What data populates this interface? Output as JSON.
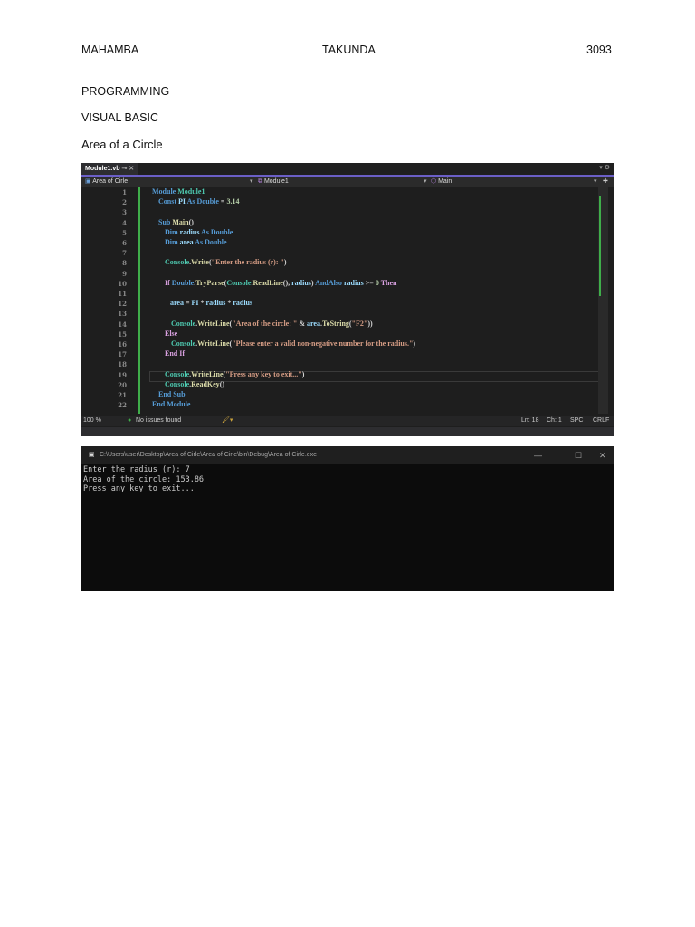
{
  "header": {
    "last_name": "MAHAMBA",
    "first_name": "TAKUNDA",
    "number": "3093"
  },
  "subject": "PROGRAMMING",
  "language": "VISUAL BASIC",
  "title": "Area of a Circle",
  "ide": {
    "tab": "Module1.vb",
    "tab_pin": "⊸",
    "tab_close": "✕",
    "nav": {
      "project": "Area of Cirle",
      "module": "Module1",
      "member": "Main"
    },
    "lines": [
      [
        [
          "Module ",
          "kw"
        ],
        [
          "Module1",
          "ty"
        ]
      ],
      [
        [
          "Const ",
          "kw"
        ],
        [
          "PI ",
          "var"
        ],
        [
          "As ",
          "kw"
        ],
        [
          "Double",
          "kw"
        ],
        [
          " = ",
          "op"
        ],
        [
          "3.14",
          "num"
        ]
      ],
      [],
      [
        [
          "Sub ",
          "kw"
        ],
        [
          "Main",
          "fn"
        ],
        [
          "()",
          "op"
        ]
      ],
      [
        [
          "Dim ",
          "kw"
        ],
        [
          "radius ",
          "var"
        ],
        [
          "As ",
          "kw"
        ],
        [
          "Double",
          "kw"
        ]
      ],
      [
        [
          "Dim ",
          "kw"
        ],
        [
          "area ",
          "var"
        ],
        [
          "As ",
          "kw"
        ],
        [
          "Double",
          "kw"
        ]
      ],
      [],
      [
        [
          "Console",
          "ty"
        ],
        [
          ".",
          "op"
        ],
        [
          "Write",
          "fn"
        ],
        [
          "(",
          "op"
        ],
        [
          "\"Enter the radius (r): \"",
          "str"
        ],
        [
          ")",
          "op"
        ]
      ],
      [],
      [
        [
          "If ",
          "ctl"
        ],
        [
          "Double",
          "kw"
        ],
        [
          ".",
          "op"
        ],
        [
          "TryParse",
          "fn"
        ],
        [
          "(",
          "op"
        ],
        [
          "Console",
          "ty"
        ],
        [
          ".",
          "op"
        ],
        [
          "ReadLine",
          "fn"
        ],
        [
          "(), ",
          "op"
        ],
        [
          "radius",
          "var"
        ],
        [
          ") ",
          "op"
        ],
        [
          "AndAlso ",
          "kw"
        ],
        [
          "radius ",
          "var"
        ],
        [
          ">= ",
          "op"
        ],
        [
          "0 ",
          "num"
        ],
        [
          "Then",
          "ctl"
        ]
      ],
      [],
      [
        [
          "area ",
          "var"
        ],
        [
          "= ",
          "op"
        ],
        [
          "PI ",
          "var"
        ],
        [
          "* ",
          "op"
        ],
        [
          "radius ",
          "var"
        ],
        [
          "* ",
          "op"
        ],
        [
          "radius",
          "var"
        ]
      ],
      [],
      [
        [
          "Console",
          "ty"
        ],
        [
          ".",
          "op"
        ],
        [
          "WriteLine",
          "fn"
        ],
        [
          "(",
          "op"
        ],
        [
          "\"Area of the circle: \"",
          "str"
        ],
        [
          " & ",
          "op"
        ],
        [
          "area",
          "var"
        ],
        [
          ".",
          "op"
        ],
        [
          "ToString",
          "fn"
        ],
        [
          "(",
          "op"
        ],
        [
          "\"F2\"",
          "str"
        ],
        [
          "))",
          "op"
        ]
      ],
      [
        [
          "Else",
          "ctl"
        ]
      ],
      [
        [
          "Console",
          "ty"
        ],
        [
          ".",
          "op"
        ],
        [
          "WriteLine",
          "fn"
        ],
        [
          "(",
          "op"
        ],
        [
          "\"Please enter a valid non-negative number for the radius.\"",
          "str"
        ],
        [
          ")",
          "op"
        ]
      ],
      [
        [
          "End If",
          "ctl"
        ]
      ],
      [],
      [
        [
          "Console",
          "ty"
        ],
        [
          ".",
          "op"
        ],
        [
          "WriteLine",
          "fn"
        ],
        [
          "(",
          "op"
        ],
        [
          "\"Press any key to exit...\"",
          "str"
        ],
        [
          ")",
          "op"
        ]
      ],
      [
        [
          "Console",
          "ty"
        ],
        [
          ".",
          "op"
        ],
        [
          "ReadKey",
          "fn"
        ],
        [
          "()",
          "op"
        ]
      ],
      [
        [
          "End Sub",
          "kw"
        ]
      ],
      [
        [
          "End Module",
          "kw"
        ]
      ]
    ],
    "status": {
      "zoom": "100 %",
      "issues": "No issues found",
      "ln": "Ln: 18",
      "ch": "Ch: 1",
      "spc": "SPC",
      "crlf": "CRLF"
    }
  },
  "console": {
    "path": "C:\\Users\\user\\Desktop\\Area of Cirle\\Area of Cirle\\bin\\Debug\\Area of Cirle.exe",
    "output": [
      "Enter the radius (r): 7",
      "Area of the circle: 153.86",
      "Press any key to exit..."
    ]
  }
}
